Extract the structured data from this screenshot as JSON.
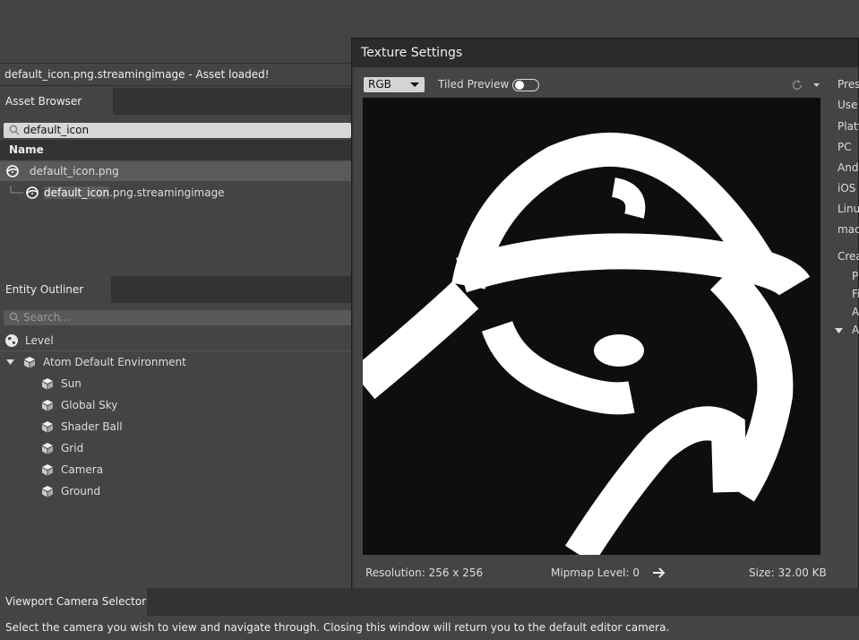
{
  "status": {
    "message": "default_icon.png.streamingimage - Asset loaded!"
  },
  "asset_browser": {
    "tab_label": "Asset Browser",
    "search_value": "default_icon",
    "column_header": "Name",
    "rows": [
      {
        "label": "default_icon.png"
      },
      {
        "highlight": "default_icon",
        "rest": ".png.streamingimage"
      }
    ]
  },
  "entity_outliner": {
    "tab_label": "Entity Outliner",
    "search_placeholder": "Search...",
    "level_label": "Level",
    "environment_label": "Atom Default Environment",
    "entities": [
      "Sun",
      "Global Sky",
      "Shader Ball",
      "Grid",
      "Camera",
      "Ground"
    ]
  },
  "texture_settings": {
    "title": "Texture Settings",
    "channel_value": "RGB",
    "tiled_preview_label": "Tiled Preview",
    "resolution_text": "Resolution: 256 x 256",
    "mipmap_text": "Mipmap Level: 0",
    "size_text": "Size: 32.00 KB",
    "side_items": [
      "Pres",
      "Use",
      "Platf",
      "PC",
      "Andr",
      "iOS",
      "Linux",
      "mac",
      "Crea",
      "Pi",
      "Fi",
      "A",
      "A"
    ]
  },
  "viewport_camera_selector": {
    "tab_label": "Viewport Camera Selector",
    "message": "Select the camera you wish to view and navigate through.  Closing this window will return you to the default editor camera."
  }
}
